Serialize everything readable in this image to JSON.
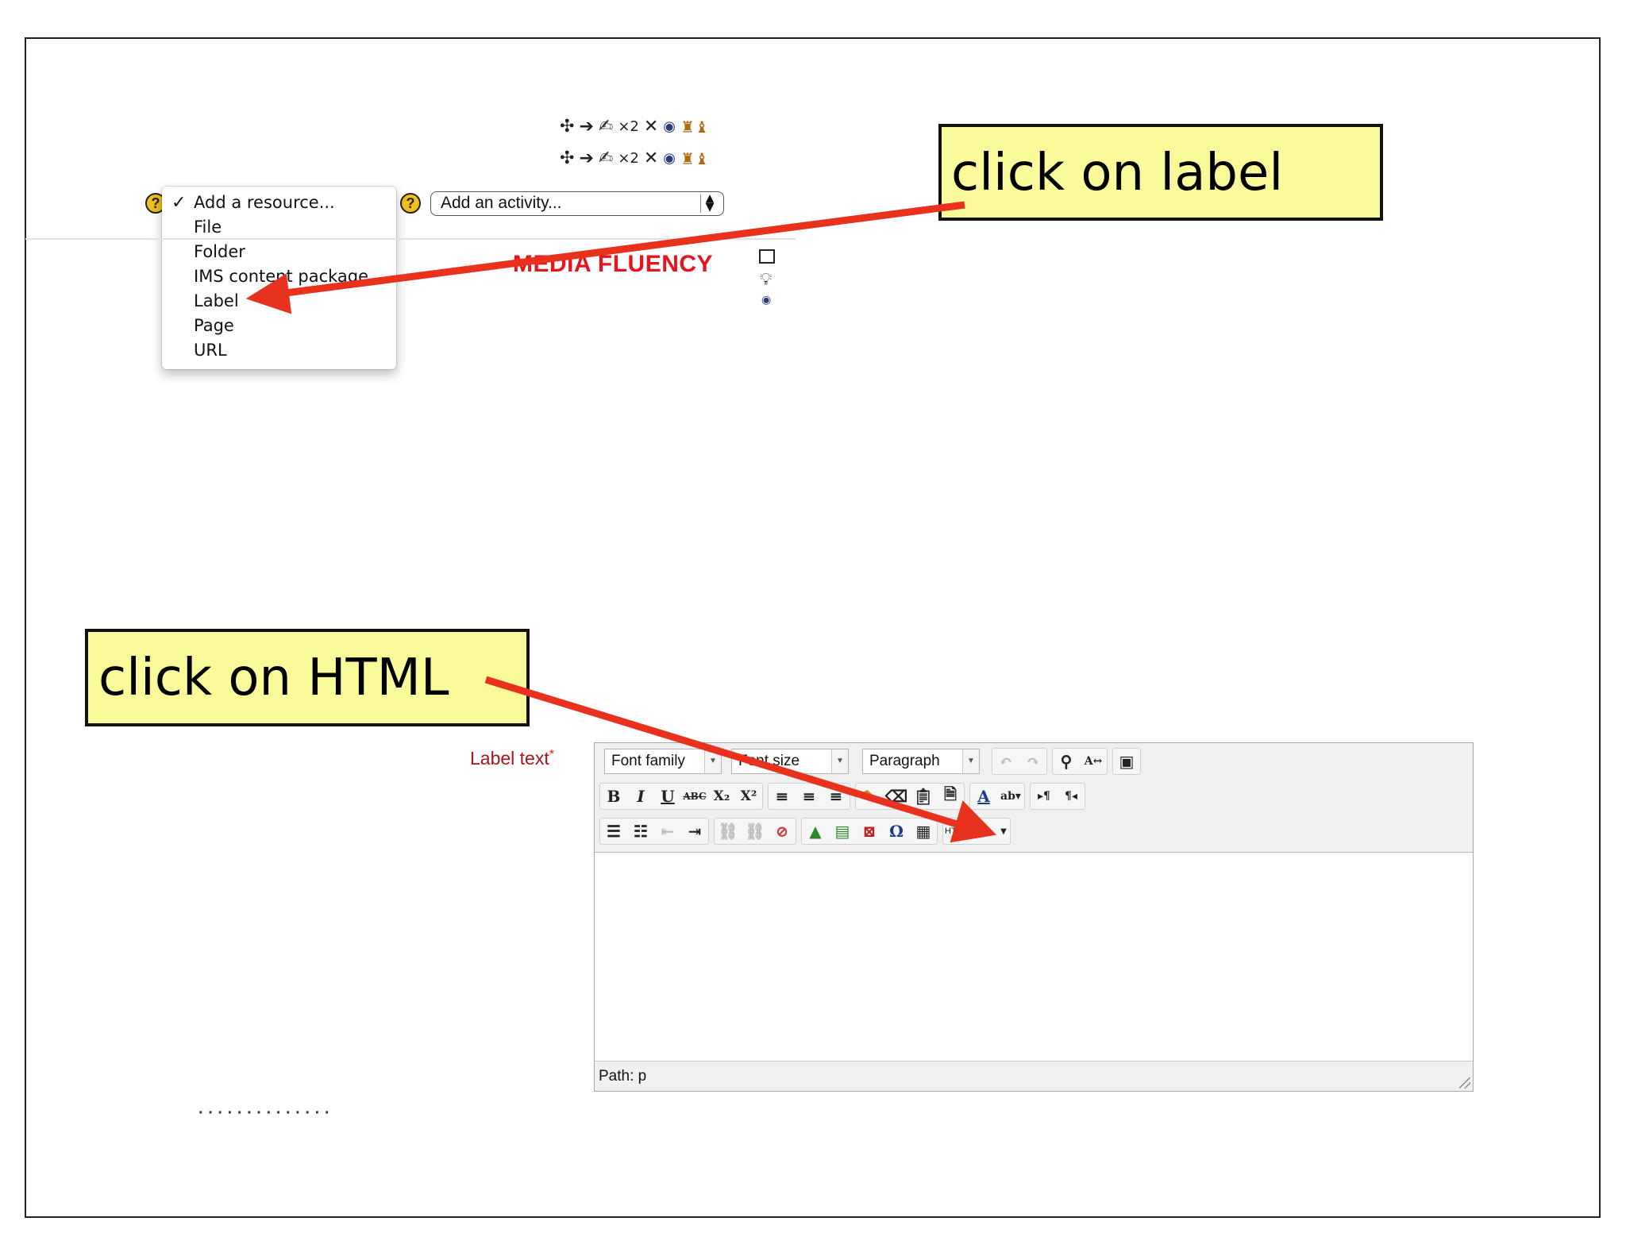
{
  "icons_top": [
    "move-icon",
    "move-right-icon",
    "edit-icon",
    "duplicate-icon",
    "delete-icon",
    "hide-icon",
    "groups-icon"
  ],
  "duplicate_label": "×2",
  "dropdown": {
    "selected": "Add a resource...",
    "items": [
      "File",
      "Folder",
      "IMS content package",
      "Label",
      "Page",
      "URL"
    ]
  },
  "help_mark": "?",
  "activity_select": {
    "value": "Add an activity..."
  },
  "section_title": "MEDIA FLUENCY",
  "callouts": {
    "label": "click on label",
    "html": "click on HTML"
  },
  "editor": {
    "field_label": "Label text",
    "required_mark": "*",
    "font_family": "Font family",
    "font_size": "Font size",
    "paragraph": "Paragraph",
    "html_button": "HTML",
    "path": "Path: p"
  },
  "colors": {
    "arrow": "#e8321e",
    "callout_bg": "#fafa9a",
    "section_title": "#e8141c",
    "required": "#a8141c"
  }
}
